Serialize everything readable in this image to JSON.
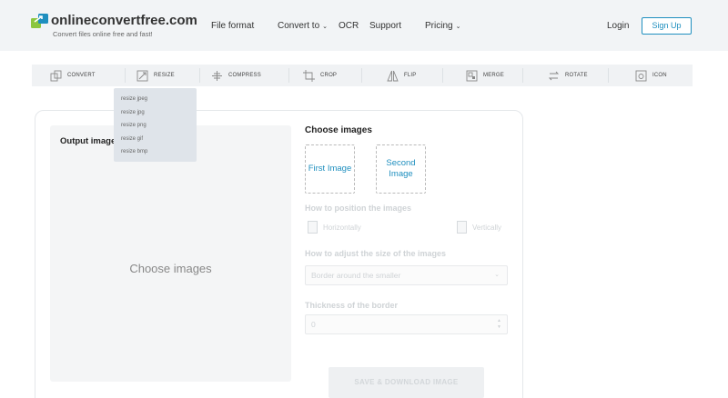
{
  "brand": {
    "name": "onlineconvertfree.com",
    "tagline": "Convert files online free and fast!",
    "colors": {
      "green": "#8cc63f",
      "blue": "#1f8fbf"
    }
  },
  "nav": {
    "file_format": "File format",
    "convert_to": "Convert to",
    "ocr": "OCR",
    "support": "Support",
    "pricing": "Pricing",
    "login": "Login",
    "signup": "Sign Up"
  },
  "toolbar": {
    "items": [
      {
        "label": "CONVERT",
        "icon": "convert-icon"
      },
      {
        "label": "RESIZE",
        "icon": "resize-icon"
      },
      {
        "label": "COMPRESS",
        "icon": "compress-icon"
      },
      {
        "label": "CROP",
        "icon": "crop-icon"
      },
      {
        "label": "FLIP",
        "icon": "flip-icon"
      },
      {
        "label": "MERGE",
        "icon": "merge-icon"
      },
      {
        "label": "ROTATE",
        "icon": "rotate-icon"
      },
      {
        "label": "ICON",
        "icon": "icon-icon"
      }
    ]
  },
  "resize_menu": {
    "items": [
      "resize jpeg",
      "resize jpg",
      "resize png",
      "resize gif",
      "resize bmp"
    ]
  },
  "main": {
    "output_label": "Output image",
    "preview_placeholder": "Choose images",
    "choose_title": "Choose images",
    "first_image": "First Image",
    "second_image": "Second Image",
    "position_title": "How to position the images",
    "horizontally": "Horizontally",
    "vertically": "Vertically",
    "adjust_title": "How to adjust the size of the images",
    "adjust_value": "Border around the smaller",
    "thickness_title": "Thickness of the border",
    "thickness_value": "0",
    "save_button": "SAVE & DOWNLOAD IMAGE"
  }
}
